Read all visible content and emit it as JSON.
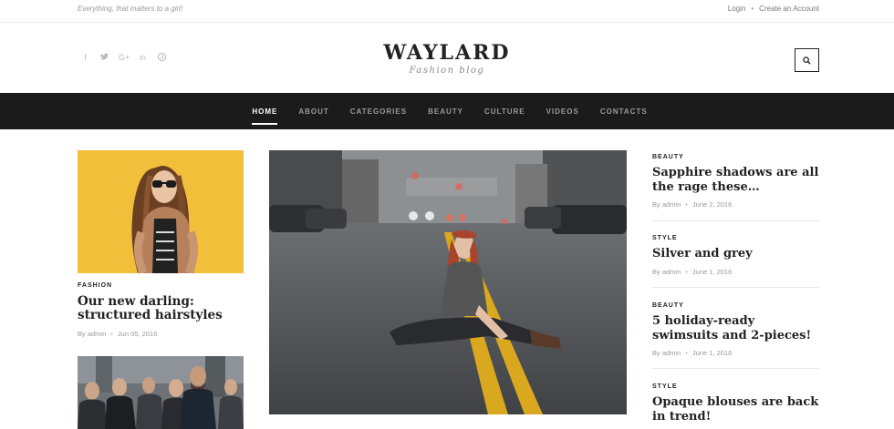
{
  "topbar": {
    "tagline": "Everything, that matters to a girl!",
    "login": "Login",
    "create_account": "Create an Account"
  },
  "header": {
    "logo_title": "WAYLARD",
    "logo_subtitle": "Fashion blog",
    "social_icons": [
      "facebook-icon",
      "twitter-icon",
      "google-plus-icon",
      "linkedin-icon",
      "pinterest-icon"
    ]
  },
  "nav": {
    "items": [
      "HOME",
      "ABOUT",
      "CATEGORIES",
      "BEAUTY",
      "CULTURE",
      "VIDEOS",
      "CONTACTS"
    ],
    "active": "HOME"
  },
  "left_posts": [
    {
      "category": "FASHION",
      "title": "Our new darling: structured hairstyles",
      "author": "By admin",
      "date": "Jun 05, 2016"
    }
  ],
  "right_posts": [
    {
      "category": "BEAUTY",
      "title": "Sapphire shadows are all the rage these…",
      "author": "By admin",
      "date": "June 2, 2016"
    },
    {
      "category": "STYLE",
      "title": "Silver and grey",
      "author": "By admin",
      "date": "June 1, 2016"
    },
    {
      "category": "BEAUTY",
      "title": "5 holiday-ready swimsuits and 2-pieces!",
      "author": "By admin",
      "date": "June 1, 2016"
    },
    {
      "category": "STYLE",
      "title": "Opaque blouses are back in trend!",
      "author": "",
      "date": ""
    }
  ],
  "colors": {
    "nav_bg": "#1b1b1b",
    "accent_yellow": "#f0b82a",
    "text_dark": "#222222"
  }
}
